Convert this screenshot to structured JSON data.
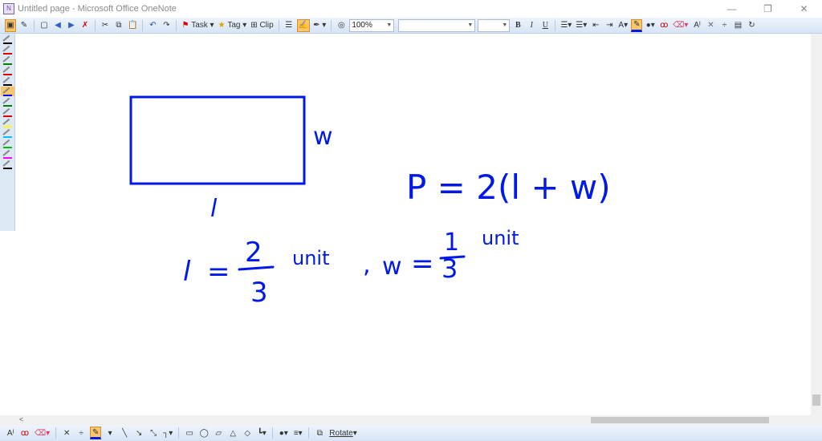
{
  "window": {
    "title": "Untitled page - Microsoft Office OneNote",
    "minimize": "—",
    "restore": "❐",
    "close": "✕"
  },
  "toolbar": {
    "task_label": "Task",
    "tag_label": "Tag",
    "clip_label": "Clip",
    "zoom_value": "100%",
    "font_value": "",
    "size_value": "",
    "bold": "B",
    "italic": "I",
    "underline": "U"
  },
  "pens": [
    "#000000",
    "#e00000",
    "#008000",
    "#e00000",
    "#000000",
    "#0000ff",
    "#008000",
    "#e00000",
    "#ffff00",
    "#00c0ff",
    "#00c000",
    "#ff00ff",
    "#000000"
  ],
  "bottom_toolbar": {
    "rotate_label": "Rotate"
  },
  "ink": {
    "side_w": "w",
    "side_l": "l",
    "perimeter": "P = 2(l + w)",
    "l_var": "l",
    "eq1": "=",
    "l_num": "2",
    "l_den": "3",
    "unit1": "unit",
    "comma": ",",
    "w_var": "w",
    "eq2": "=",
    "w_num": "1",
    "w_den": "3",
    "unit2": "unit"
  },
  "colors": {
    "ink": "#0019e6",
    "accent": "#f9c66b"
  }
}
